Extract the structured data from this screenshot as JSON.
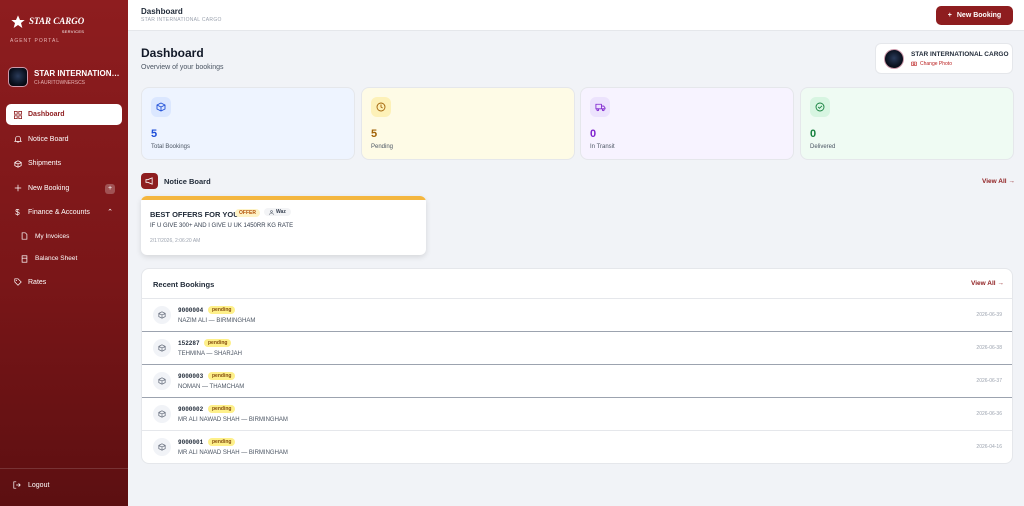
{
  "sidebar": {
    "logo_text": "STAR CARGO",
    "logo_sub": "SERVICES",
    "portal_label": "AGENT PORTAL",
    "profile_name": "STAR INTERNATIONAL CARGO",
    "profile_sub": "CI-AURITOWNERSCS",
    "items": [
      {
        "label": "Dashboard",
        "icon": "grid-icon"
      },
      {
        "label": "Notice Board",
        "icon": "bell-icon"
      },
      {
        "label": "Shipments",
        "icon": "box-icon"
      },
      {
        "label": "New Booking",
        "icon": "plus-icon",
        "badge": "+"
      },
      {
        "label": "Finance & Accounts",
        "icon": "dollar-icon"
      },
      {
        "label": "My Invoices",
        "icon": "doc-icon"
      },
      {
        "label": "Balance Sheet",
        "icon": "sheet-icon"
      },
      {
        "label": "Rates",
        "icon": "tag-icon"
      }
    ],
    "logout_label": "Logout"
  },
  "topbar": {
    "title": "Dashboard",
    "subtitle": "STAR INTERNATIONAL CARGO",
    "new_booking_label": "New Booking"
  },
  "main": {
    "title": "Dashboard",
    "subtitle": "Overview of your bookings",
    "company": {
      "name": "STAR INTERNATIONAL CARGO",
      "change_photo": "Change Photo"
    },
    "stats": [
      {
        "value": "5",
        "label": "Total Bookings",
        "color": "#1d4ed8",
        "bg": "#eef4ff",
        "icon_bg": "#dbe7ff"
      },
      {
        "value": "5",
        "label": "Pending",
        "color": "#a16207",
        "bg": "#fefbe6",
        "icon_bg": "#fdf1b8"
      },
      {
        "value": "0",
        "label": "In Transit",
        "color": "#7e22ce",
        "bg": "#f7f3ff",
        "icon_bg": "#ece3fd"
      },
      {
        "value": "0",
        "label": "Delivered",
        "color": "#15803d",
        "bg": "#effbf3",
        "icon_bg": "#d7f5e1"
      }
    ],
    "notice_board": {
      "title": "Notice Board",
      "view_all": "View All →",
      "notice": {
        "title": "BEST OFFERS FOR YOU",
        "badge": "OFFER",
        "author": "Waz",
        "body": "IF U GIVE 300+ AND I GIVE U UK 1450RR KG RATE",
        "time": "2/17/2026, 2:06:20 AM"
      }
    },
    "recent": {
      "title": "Recent Bookings",
      "view_all": "View All →",
      "status_label": "pending",
      "rows": [
        {
          "id": "9000004",
          "route": "NAZIM ALI — BIRMINGHAM",
          "date": "2026-06-39"
        },
        {
          "id": "152287",
          "route": "TEHMINA — SHARJAH",
          "date": "2026-06-38"
        },
        {
          "id": "9000003",
          "route": "NOMAN — THAMCHAM",
          "date": "2026-06-37"
        },
        {
          "id": "9000002",
          "route": "MR ALI NAWAD SHAH — BIRMINGHAM",
          "date": "2026-06-36"
        },
        {
          "id": "9000001",
          "route": "MR ALI NAWAD SHAH — BIRMINGHAM",
          "date": "2026-04-16"
        }
      ]
    }
  }
}
